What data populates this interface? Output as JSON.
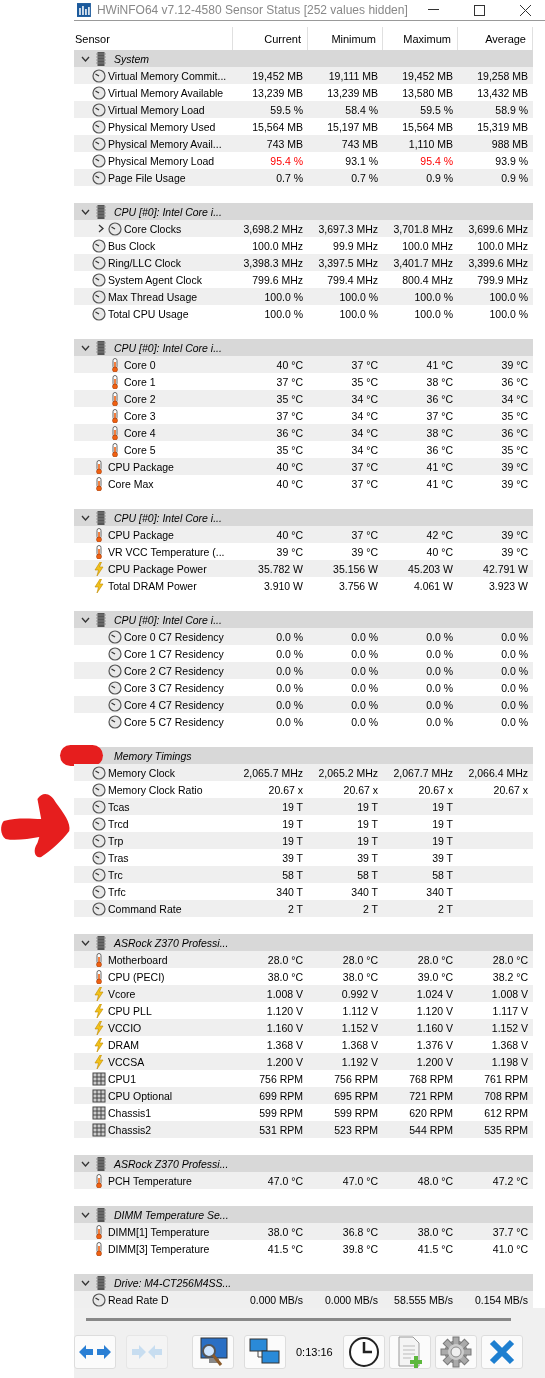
{
  "window": {
    "title": "HWiNFO64 v7.12-4580 Sensor Status [252 values hidden]"
  },
  "columns": [
    "Sensor",
    "Current",
    "Minimum",
    "Maximum",
    "Average"
  ],
  "groups": [
    {
      "name": "System",
      "expanded": true,
      "marked": false,
      "rows": [
        {
          "kind": "gauge",
          "label": "Virtual Memory Commit...",
          "values": [
            "19,452 MB",
            "19,111 MB",
            "19,452 MB",
            "19,258 MB"
          ]
        },
        {
          "kind": "gauge",
          "label": "Virtual Memory Available",
          "values": [
            "13,239 MB",
            "13,239 MB",
            "13,580 MB",
            "13,432 MB"
          ]
        },
        {
          "kind": "gauge",
          "label": "Virtual Memory Load",
          "values": [
            "59.5 %",
            "58.4 %",
            "59.5 %",
            "58.9 %"
          ]
        },
        {
          "kind": "gauge",
          "label": "Physical Memory Used",
          "values": [
            "15,564 MB",
            "15,197 MB",
            "15,564 MB",
            "15,319 MB"
          ]
        },
        {
          "kind": "gauge",
          "label": "Physical Memory Avail...",
          "values": [
            "743 MB",
            "743 MB",
            "1,110 MB",
            "988 MB"
          ]
        },
        {
          "kind": "gauge",
          "label": "Physical Memory Load",
          "values": [
            "95.4 %",
            "93.1 %",
            "95.4 %",
            "93.9 %"
          ],
          "alerts": [
            true,
            false,
            true,
            false
          ]
        },
        {
          "kind": "gauge",
          "label": "Page File Usage",
          "values": [
            "0.7 %",
            "0.7 %",
            "0.9 %",
            "0.9 %"
          ]
        }
      ]
    },
    {
      "name": "CPU [#0]: Intel Core i...",
      "expanded": true,
      "marked": false,
      "rows": [
        {
          "kind": "gauge",
          "label": "Core Clocks",
          "values": [
            "3,698.2 MHz",
            "3,697.3 MHz",
            "3,701.8 MHz",
            "3,699.6 MHz"
          ],
          "expandable": true,
          "expanded": false
        },
        {
          "kind": "gauge",
          "label": "Bus Clock",
          "values": [
            "100.0 MHz",
            "99.9 MHz",
            "100.0 MHz",
            "100.0 MHz"
          ]
        },
        {
          "kind": "gauge",
          "label": "Ring/LLC Clock",
          "values": [
            "3,398.3 MHz",
            "3,397.5 MHz",
            "3,401.7 MHz",
            "3,399.6 MHz"
          ]
        },
        {
          "kind": "gauge",
          "label": "System Agent Clock",
          "values": [
            "799.6 MHz",
            "799.4 MHz",
            "800.4 MHz",
            "799.9 MHz"
          ]
        },
        {
          "kind": "gauge",
          "label": "Max Thread Usage",
          "values": [
            "100.0 %",
            "100.0 %",
            "100.0 %",
            "100.0 %"
          ]
        },
        {
          "kind": "gauge",
          "label": "Total CPU Usage",
          "values": [
            "100.0 %",
            "100.0 %",
            "100.0 %",
            "100.0 %"
          ]
        }
      ]
    },
    {
      "name": "CPU [#0]: Intel Core i...",
      "expanded": true,
      "marked": false,
      "rows": [
        {
          "kind": "temp",
          "label": "Core 0",
          "values": [
            "40 °C",
            "37 °C",
            "41 °C",
            "39 °C"
          ],
          "nested": true
        },
        {
          "kind": "temp",
          "label": "Core 1",
          "values": [
            "37 °C",
            "35 °C",
            "38 °C",
            "36 °C"
          ],
          "nested": true
        },
        {
          "kind": "temp",
          "label": "Core 2",
          "values": [
            "35 °C",
            "34 °C",
            "36 °C",
            "34 °C"
          ],
          "nested": true
        },
        {
          "kind": "temp",
          "label": "Core 3",
          "values": [
            "37 °C",
            "34 °C",
            "37 °C",
            "35 °C"
          ],
          "nested": true
        },
        {
          "kind": "temp",
          "label": "Core 4",
          "values": [
            "36 °C",
            "34 °C",
            "38 °C",
            "36 °C"
          ],
          "nested": true
        },
        {
          "kind": "temp",
          "label": "Core 5",
          "values": [
            "35 °C",
            "34 °C",
            "36 °C",
            "35 °C"
          ],
          "nested": true
        },
        {
          "kind": "temp",
          "label": "CPU Package",
          "values": [
            "40 °C",
            "37 °C",
            "41 °C",
            "39 °C"
          ]
        },
        {
          "kind": "temp",
          "label": "Core Max",
          "values": [
            "40 °C",
            "37 °C",
            "41 °C",
            "39 °C"
          ]
        }
      ]
    },
    {
      "name": "CPU [#0]: Intel Core i...",
      "expanded": true,
      "marked": false,
      "rows": [
        {
          "kind": "temp",
          "label": "CPU Package",
          "values": [
            "40 °C",
            "37 °C",
            "42 °C",
            "39 °C"
          ]
        },
        {
          "kind": "temp",
          "label": "VR VCC Temperature (...",
          "values": [
            "39 °C",
            "39 °C",
            "40 °C",
            "39 °C"
          ]
        },
        {
          "kind": "power",
          "label": "CPU Package Power",
          "values": [
            "35.782 W",
            "35.156 W",
            "45.203 W",
            "42.791 W"
          ]
        },
        {
          "kind": "power",
          "label": "Total DRAM Power",
          "values": [
            "3.910 W",
            "3.756 W",
            "4.061 W",
            "3.923 W"
          ]
        }
      ]
    },
    {
      "name": "CPU [#0]: Intel Core i...",
      "expanded": true,
      "marked": false,
      "rows": [
        {
          "kind": "gauge",
          "label": "Core 0 C7 Residency",
          "values": [
            "0.0 %",
            "0.0 %",
            "0.0 %",
            "0.0 %"
          ],
          "nested": true
        },
        {
          "kind": "gauge",
          "label": "Core 1 C7 Residency",
          "values": [
            "0.0 %",
            "0.0 %",
            "0.0 %",
            "0.0 %"
          ],
          "nested": true
        },
        {
          "kind": "gauge",
          "label": "Core 2 C7 Residency",
          "values": [
            "0.0 %",
            "0.0 %",
            "0.0 %",
            "0.0 %"
          ],
          "nested": true
        },
        {
          "kind": "gauge",
          "label": "Core 3 C7 Residency",
          "values": [
            "0.0 %",
            "0.0 %",
            "0.0 %",
            "0.0 %"
          ],
          "nested": true
        },
        {
          "kind": "gauge",
          "label": "Core 4 C7 Residency",
          "values": [
            "0.0 %",
            "0.0 %",
            "0.0 %",
            "0.0 %"
          ],
          "nested": true
        },
        {
          "kind": "gauge",
          "label": "Core 5 C7 Residency",
          "values": [
            "0.0 %",
            "0.0 %",
            "0.0 %",
            "0.0 %"
          ],
          "nested": true
        }
      ]
    },
    {
      "name": "Memory Timings",
      "expanded": true,
      "marked": true,
      "rows": [
        {
          "kind": "gauge",
          "label": "Memory Clock",
          "values": [
            "2,065.7 MHz",
            "2,065.2 MHz",
            "2,067.7 MHz",
            "2,066.4 MHz"
          ]
        },
        {
          "kind": "gauge",
          "label": "Memory Clock Ratio",
          "values": [
            "20.67 x",
            "20.67 x",
            "20.67 x",
            "20.67 x"
          ]
        },
        {
          "kind": "gauge",
          "label": "Tcas",
          "values": [
            "19 T",
            "19 T",
            "19 T"
          ]
        },
        {
          "kind": "gauge",
          "label": "Trcd",
          "values": [
            "19 T",
            "19 T",
            "19 T"
          ],
          "pointed": true
        },
        {
          "kind": "gauge",
          "label": "Trp",
          "values": [
            "19 T",
            "19 T",
            "19 T"
          ]
        },
        {
          "kind": "gauge",
          "label": "Tras",
          "values": [
            "39 T",
            "39 T",
            "39 T"
          ]
        },
        {
          "kind": "gauge",
          "label": "Trc",
          "values": [
            "58 T",
            "58 T",
            "58 T"
          ]
        },
        {
          "kind": "gauge",
          "label": "Trfc",
          "values": [
            "340 T",
            "340 T",
            "340 T"
          ]
        },
        {
          "kind": "gauge",
          "label": "Command Rate",
          "values": [
            "2 T",
            "2 T",
            "2 T"
          ]
        }
      ]
    },
    {
      "name": "ASRock Z370 Professi...",
      "expanded": true,
      "marked": false,
      "rows": [
        {
          "kind": "temp",
          "label": "Motherboard",
          "values": [
            "28.0 °C",
            "28.0 °C",
            "28.0 °C",
            "28.0 °C"
          ]
        },
        {
          "kind": "temp",
          "label": "CPU (PECI)",
          "values": [
            "38.0 °C",
            "38.0 °C",
            "39.0 °C",
            "38.2 °C"
          ]
        },
        {
          "kind": "power",
          "label": "Vcore",
          "values": [
            "1.008 V",
            "0.992 V",
            "1.024 V",
            "1.008 V"
          ]
        },
        {
          "kind": "power",
          "label": "CPU PLL",
          "values": [
            "1.120 V",
            "1.112 V",
            "1.120 V",
            "1.117 V"
          ]
        },
        {
          "kind": "power",
          "label": "VCCIO",
          "values": [
            "1.160 V",
            "1.152 V",
            "1.160 V",
            "1.152 V"
          ]
        },
        {
          "kind": "power",
          "label": "DRAM",
          "values": [
            "1.368 V",
            "1.368 V",
            "1.376 V",
            "1.368 V"
          ]
        },
        {
          "kind": "power",
          "label": "VCCSA",
          "values": [
            "1.200 V",
            "1.192 V",
            "1.200 V",
            "1.198 V"
          ]
        },
        {
          "kind": "fan",
          "label": "CPU1",
          "values": [
            "756 RPM",
            "756 RPM",
            "768 RPM",
            "761 RPM"
          ]
        },
        {
          "kind": "fan",
          "label": "CPU Optional",
          "values": [
            "699 RPM",
            "695 RPM",
            "721 RPM",
            "708 RPM"
          ]
        },
        {
          "kind": "fan",
          "label": "Chassis1",
          "values": [
            "599 RPM",
            "599 RPM",
            "620 RPM",
            "612 RPM"
          ]
        },
        {
          "kind": "fan",
          "label": "Chassis2",
          "values": [
            "531 RPM",
            "523 RPM",
            "544 RPM",
            "535 RPM"
          ]
        }
      ]
    },
    {
      "name": "ASRock Z370 Professi...",
      "expanded": true,
      "marked": false,
      "rows": [
        {
          "kind": "temp",
          "label": "PCH Temperature",
          "values": [
            "47.0 °C",
            "47.0 °C",
            "48.0 °C",
            "47.2 °C"
          ]
        }
      ]
    },
    {
      "name": "DIMM Temperature Se...",
      "expanded": true,
      "marked": false,
      "rows": [
        {
          "kind": "temp",
          "label": "DIMM[1] Temperature",
          "values": [
            "38.0 °C",
            "36.8 °C",
            "38.0 °C",
            "37.7 °C"
          ]
        },
        {
          "kind": "temp",
          "label": "DIMM[3] Temperature",
          "values": [
            "41.5 °C",
            "39.8 °C",
            "41.5 °C",
            "41.0 °C"
          ]
        }
      ]
    },
    {
      "name": "Drive: M4-CT256M4SS...",
      "expanded": true,
      "marked": false,
      "rows": [
        {
          "kind": "gauge",
          "label": "Read Rate D",
          "values": [
            "0.000 MB/s",
            "0.000 MB/s",
            "58.555 MB/s",
            "0.154 MB/s"
          ]
        }
      ]
    }
  ],
  "toolbar": {
    "buttons": [
      {
        "kind": "expand",
        "disabled": false
      },
      {
        "kind": "collapse",
        "disabled": true
      },
      {
        "kind": "monitor-search",
        "disabled": false
      },
      {
        "kind": "network",
        "disabled": false
      }
    ],
    "timer": "0:13:16",
    "buttons_right": [
      {
        "kind": "clock",
        "disabled": false
      },
      {
        "kind": "log",
        "disabled": false
      },
      {
        "kind": "settings",
        "disabled": false
      },
      {
        "kind": "close",
        "disabled": false
      }
    ]
  }
}
